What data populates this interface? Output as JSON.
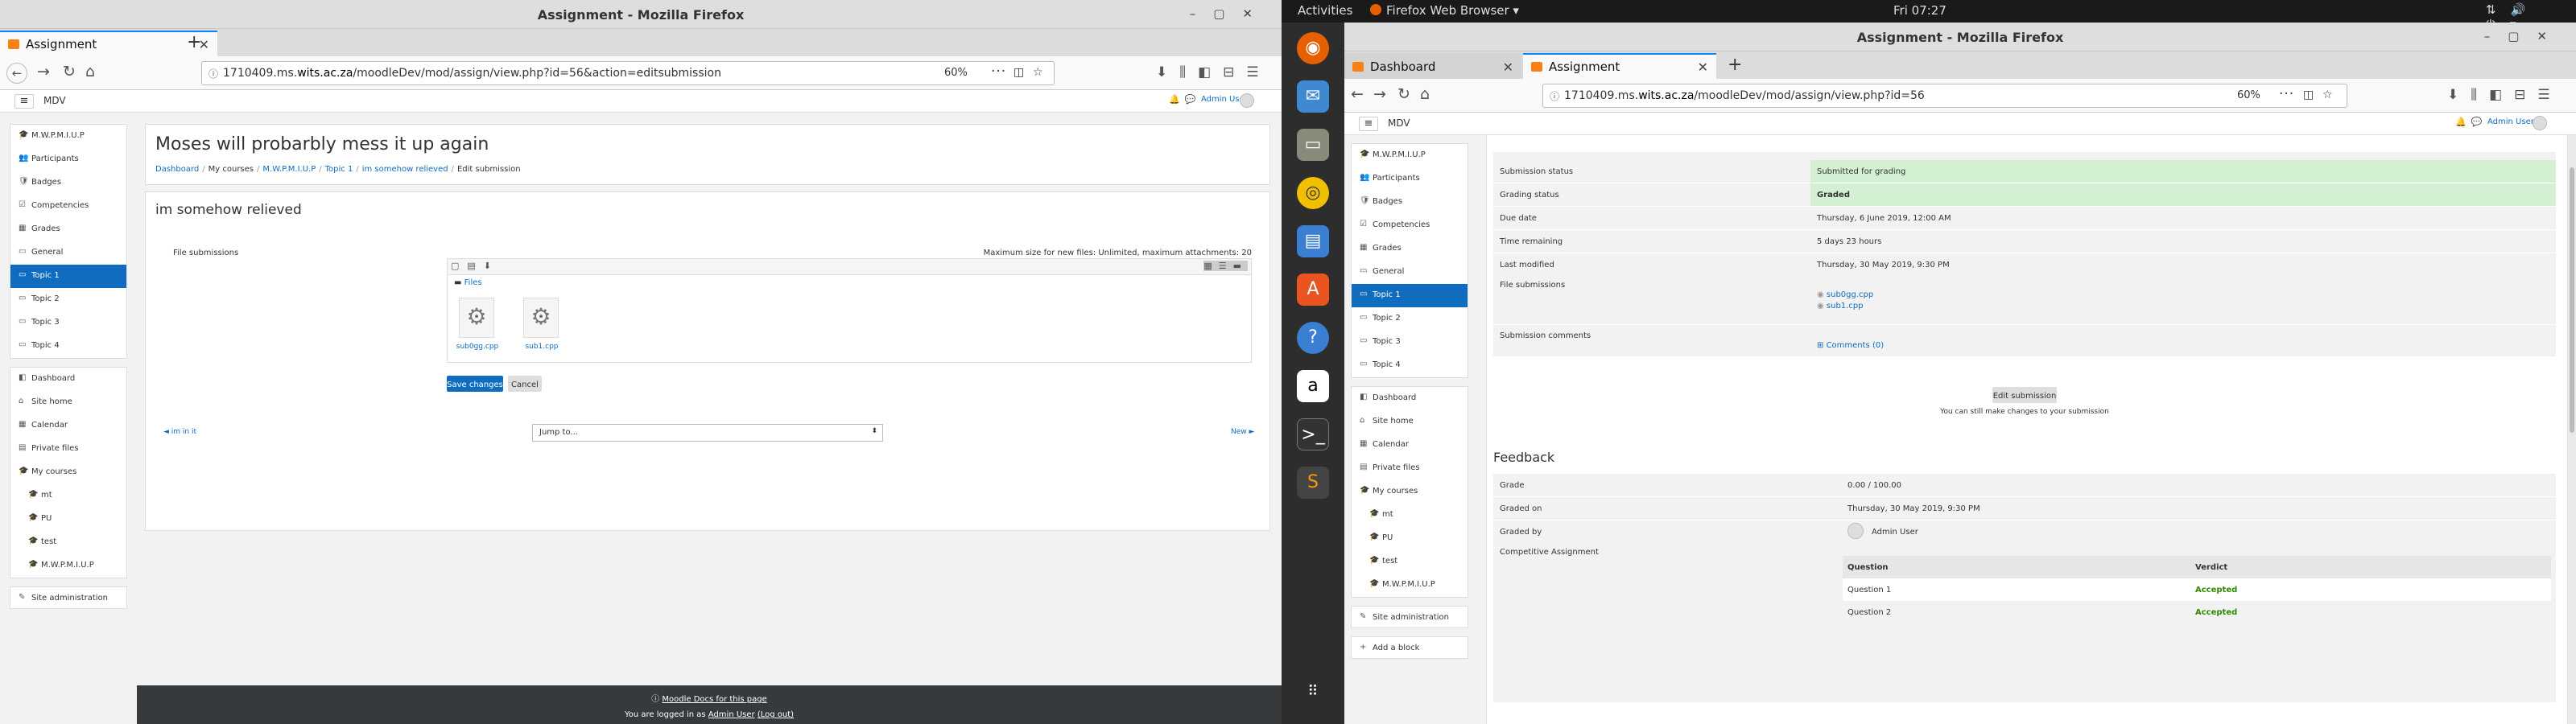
{
  "left_window": {
    "title": "Assignment - Mozilla Firefox",
    "tab_label": "Assignment",
    "url_prefix": "1710409.ms.",
    "url_domain": "wits.ac.za",
    "url_suffix": "/moodleDev/mod/assign/view.php?id=56&action=editsubmission",
    "zoom": "60%",
    "brand": "MDV",
    "user": "Admin User",
    "nav": [
      {
        "label": "M.W.P.M.I.U.P",
        "icon": "graduation-cap-icon"
      },
      {
        "label": "Participants",
        "icon": "users-icon"
      },
      {
        "label": "Badges",
        "icon": "badge-icon"
      },
      {
        "label": "Competencies",
        "icon": "check-square-icon"
      },
      {
        "label": "Grades",
        "icon": "table-icon"
      },
      {
        "label": "General",
        "icon": "folder-icon"
      },
      {
        "label": "Topic 1",
        "icon": "folder-icon",
        "active": true
      },
      {
        "label": "Topic 2",
        "icon": "folder-icon"
      },
      {
        "label": "Topic 3",
        "icon": "folder-icon"
      },
      {
        "label": "Topic 4",
        "icon": "folder-icon"
      }
    ],
    "nav2": [
      {
        "label": "Dashboard",
        "icon": "dashboard-icon"
      },
      {
        "label": "Site home",
        "icon": "home-icon"
      },
      {
        "label": "Calendar",
        "icon": "calendar-icon"
      },
      {
        "label": "Private files",
        "icon": "file-icon"
      },
      {
        "label": "My courses",
        "icon": "graduation-cap-icon"
      },
      {
        "label": "mt",
        "icon": "graduation-cap-icon",
        "sub": true
      },
      {
        "label": "PU",
        "icon": "graduation-cap-icon",
        "sub": true
      },
      {
        "label": "test",
        "icon": "graduation-cap-icon",
        "sub": true
      },
      {
        "label": "M.W.P.M.I.U.P",
        "icon": "graduation-cap-icon",
        "sub": true
      }
    ],
    "site_admin": "Site administration",
    "page_title": "Moses will probarbly mess it up again",
    "breadcrumb": [
      "Dashboard",
      "My courses",
      "M.W.P.M.I.U.P",
      "Topic 1",
      "im somehow relieved",
      "Edit submission"
    ],
    "section_title": "im somehow relieved",
    "file_submissions_label": "File submissions",
    "max_size_text": "Maximum size for new files: Unlimited, maximum attachments: 20",
    "files_label": "Files",
    "files": [
      "sub0gg.cpp",
      "sub1.cpp"
    ],
    "save_label": "Save changes",
    "cancel_label": "Cancel",
    "prev_link": "◄ im in it",
    "jump_to": "Jump to...",
    "next_link": "New ►",
    "footer_docs": "Moodle Docs for this page",
    "footer_logged_prefix": "You are logged in as",
    "footer_user": "Admin User",
    "footer_logout": "(Log out)"
  },
  "topbar": {
    "activities": "Activities",
    "app": "Firefox Web Browser ▾",
    "clock": "Fri 07:27"
  },
  "right_window": {
    "title": "Assignment - Mozilla Firefox",
    "tabs": [
      "Dashboard",
      "Assignment"
    ],
    "url_prefix": "1710409.ms.",
    "url_domain": "wits.ac.za",
    "url_suffix": "/moodleDev/mod/assign/view.php?id=56",
    "zoom": "60%",
    "brand": "MDV",
    "user": "Admin User",
    "nav": [
      {
        "label": "M.W.P.M.I.U.P",
        "icon": "graduation-cap-icon"
      },
      {
        "label": "Participants",
        "icon": "users-icon"
      },
      {
        "label": "Badges",
        "icon": "badge-icon"
      },
      {
        "label": "Competencies",
        "icon": "check-square-icon"
      },
      {
        "label": "Grades",
        "icon": "table-icon"
      },
      {
        "label": "General",
        "icon": "folder-icon"
      },
      {
        "label": "Topic 1",
        "icon": "folder-icon",
        "active": true
      },
      {
        "label": "Topic 2",
        "icon": "folder-icon"
      },
      {
        "label": "Topic 3",
        "icon": "folder-icon"
      },
      {
        "label": "Topic 4",
        "icon": "folder-icon"
      }
    ],
    "nav2": [
      {
        "label": "Dashboard",
        "icon": "dashboard-icon"
      },
      {
        "label": "Site home",
        "icon": "home-icon"
      },
      {
        "label": "Calendar",
        "icon": "calendar-icon"
      },
      {
        "label": "Private files",
        "icon": "file-icon"
      },
      {
        "label": "My courses",
        "icon": "graduation-cap-icon"
      },
      {
        "label": "mt",
        "icon": "graduation-cap-icon",
        "sub": true
      },
      {
        "label": "PU",
        "icon": "graduation-cap-icon",
        "sub": true
      },
      {
        "label": "test",
        "icon": "graduation-cap-icon",
        "sub": true
      },
      {
        "label": "M.W.P.M.I.U.P",
        "icon": "graduation-cap-icon",
        "sub": true
      }
    ],
    "site_admin": "Site administration",
    "add_block": "Add a block",
    "status_rows": [
      {
        "label": "Submission status",
        "value": "Submitted for grading",
        "green": true
      },
      {
        "label": "Grading status",
        "value": "Graded",
        "green": true,
        "bold": true
      },
      {
        "label": "Due date",
        "value": "Thursday, 6 June 2019, 12:00 AM"
      },
      {
        "label": "Time remaining",
        "value": "5 days 23 hours"
      },
      {
        "label": "Last modified",
        "value": "Thursday, 30 May 2019, 9:30 PM"
      }
    ],
    "file_submissions_label": "File submissions",
    "files": [
      "sub0gg.cpp",
      "sub1.cpp"
    ],
    "comments_label": "Submission comments",
    "comments_link": "Comments (0)",
    "edit_submission": "Edit submission",
    "edit_hint": "You can still make changes to your submission",
    "feedback_title": "Feedback",
    "feedback_rows": [
      {
        "label": "Grade",
        "value": "0.00 / 100.00"
      },
      {
        "label": "Graded on",
        "value": "Thursday, 30 May 2019, 9:30 PM"
      },
      {
        "label": "Graded by",
        "value": "Admin User"
      }
    ],
    "competitive_label": "Competitive Assignment",
    "comp_headers": [
      "Question",
      "Verdict"
    ],
    "comp_rows": [
      [
        "Question 1",
        "Accepted"
      ],
      [
        "Question 2",
        "Accepted"
      ]
    ]
  },
  "colors": {
    "accent": "#0f6cbf",
    "green_bg": "#d4f0d2",
    "accepted": "#2e8b00",
    "footer": "#373a3c"
  }
}
